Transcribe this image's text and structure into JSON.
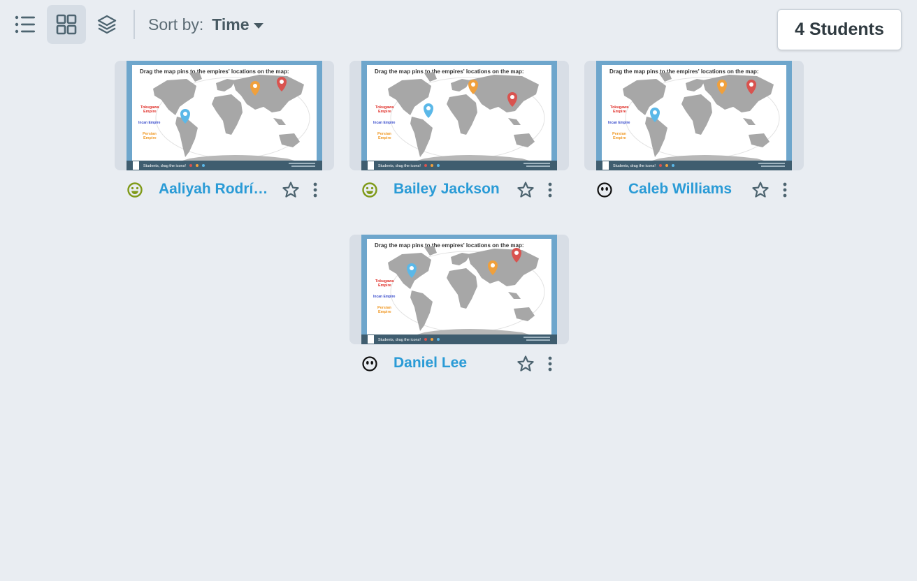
{
  "toolbar": {
    "list_view_icon": "list-icon",
    "grid_view_icon": "grid-icon",
    "layers_icon": "layers-icon",
    "sort_label": "Sort by:",
    "sort_value": "Time",
    "student_count": "4 Students"
  },
  "colors": {
    "background": "#e9edf2",
    "name_link": "#2a9bd6",
    "happy_face": "#7f9a18",
    "neutral_face": "#111111",
    "pin_red": "#d9534f",
    "pin_orange": "#f0a03c",
    "pin_blue": "#5bb8e8"
  },
  "slide": {
    "prompt": "Drag the map pins to the empires' locations on the map:",
    "legend_tokugawa_line1": "Tokugawa",
    "legend_tokugawa_line2": "Empire",
    "legend_incan": "Incan Empire",
    "legend_persian_line1": "Persian",
    "legend_persian_line2": "Empire",
    "footer": "Students, drag the icons!"
  },
  "students": [
    {
      "name": "Aaliyah Rodríguez",
      "status_icon": "happy-face-icon",
      "star_icon": "star-outline-icon",
      "menu_icon": "more-vertical-icon"
    },
    {
      "name": "Bailey Jackson",
      "status_icon": "happy-face-icon",
      "star_icon": "star-outline-icon",
      "menu_icon": "more-vertical-icon"
    },
    {
      "name": "Caleb Williams",
      "status_icon": "neutral-face-icon",
      "star_icon": "star-outline-icon",
      "menu_icon": "more-vertical-icon"
    },
    {
      "name": "Daniel Lee",
      "status_icon": "neutral-face-icon",
      "star_icon": "star-outline-icon",
      "menu_icon": "more-vertical-icon"
    }
  ]
}
